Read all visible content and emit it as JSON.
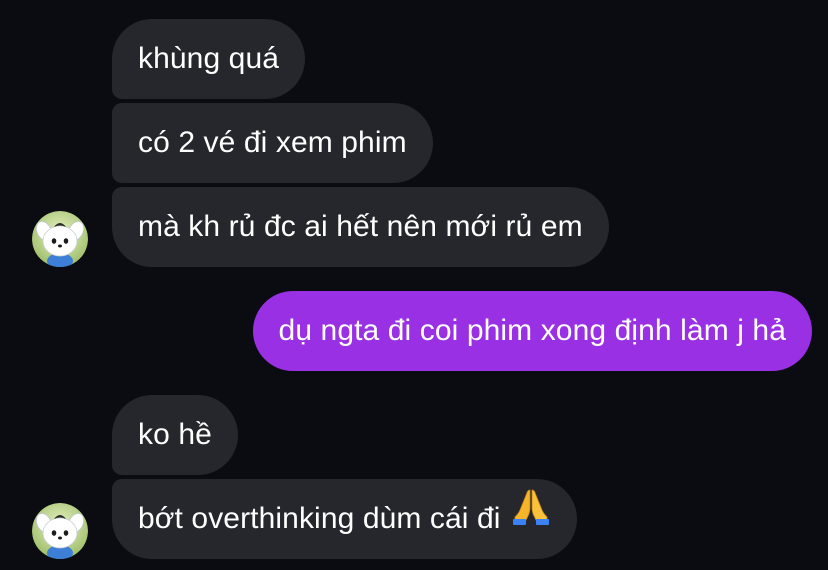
{
  "messages": [
    {
      "id": 1,
      "sender": "them",
      "text": "khùng quá"
    },
    {
      "id": 2,
      "sender": "them",
      "text": "có 2 vé đi xem phim"
    },
    {
      "id": 3,
      "sender": "them",
      "text": "mà kh rủ đc ai hết nên mới rủ em"
    },
    {
      "id": 4,
      "sender": "me",
      "text": "dụ ngta đi coi phim xong định làm j hả"
    },
    {
      "id": 5,
      "sender": "them",
      "text": "ko hề"
    },
    {
      "id": 6,
      "sender": "them",
      "text": "bớt overthinking dùm cái đi",
      "emoji": "folded-hands-emoji"
    }
  ],
  "colors": {
    "background": "#0b0c12",
    "incoming_bubble": "#26272d",
    "outgoing_bubble": "#9a30e4",
    "text": "#ffffff"
  },
  "avatar": {
    "icon": "puppy-avatar-icon"
  }
}
